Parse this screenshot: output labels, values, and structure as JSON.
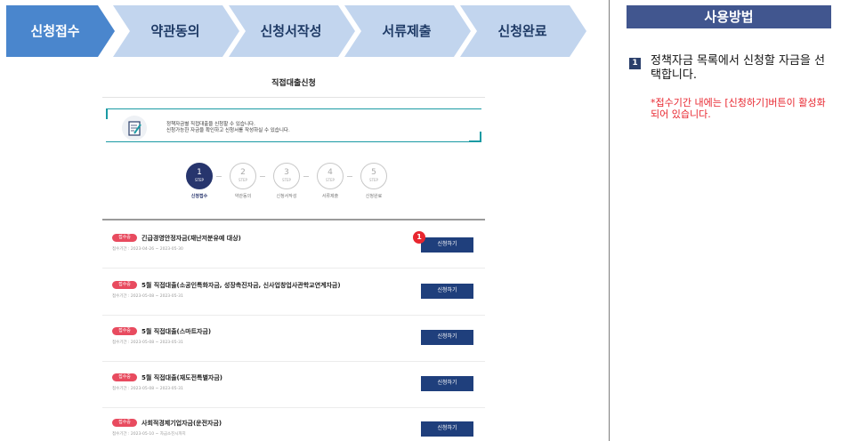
{
  "top_steps": [
    {
      "label": "신청접수",
      "active": true
    },
    {
      "label": "약관동의",
      "active": false
    },
    {
      "label": "신청서작성",
      "active": false
    },
    {
      "label": "서류제출",
      "active": false
    },
    {
      "label": "신청완료",
      "active": false
    }
  ],
  "colors": {
    "active_step": "#4a86cd",
    "inactive_step": "#c2d5ee",
    "guide_head": "#41568f",
    "apply_button": "#1f3f7c",
    "badge": "#e84b5f",
    "note": "#e8262f"
  },
  "guide": {
    "title": "사용방법",
    "step_number": "1",
    "instruction": "정책자금 목록에서 신청할 자금을 선택합니다.",
    "note": "*접수기간 내에는 [신청하기]버튼이 활성화 되어 있습니다."
  },
  "screen": {
    "page_title": "직접대출신청",
    "info_icon": "edit-document-icon",
    "info_lines": [
      "정책자금별 직접대출을 신청할 수 있습니다.",
      "신청가능한 자금을 확인하고 신청서를 작성하실 수 있습니다."
    ],
    "steps": [
      {
        "number": "1",
        "tag": "STEP",
        "label": "신청접수",
        "active": true
      },
      {
        "number": "2",
        "tag": "STEP",
        "label": "약관동의",
        "active": false
      },
      {
        "number": "3",
        "tag": "STEP",
        "label": "신청서작성",
        "active": false
      },
      {
        "number": "4",
        "tag": "STEP",
        "label": "서류제출",
        "active": false
      },
      {
        "number": "5",
        "tag": "STEP",
        "label": "신청완료",
        "active": false
      }
    ],
    "marker": "1",
    "items": [
      {
        "badge": "접수중",
        "title": "긴급경영안정자금(재난저분유예 대상)",
        "period": "접수기간 : 2023-04-26 ~ 2023-05-30",
        "button": "신청하기"
      },
      {
        "badge": "접수중",
        "title": "5월 직접대출(소공인특화자금, 성장촉진자금, 신사업창업사관학교연계자금)",
        "period": "접수기간 : 2023-05-08 ~ 2023-05-31",
        "button": "신청하기"
      },
      {
        "badge": "접수중",
        "title": "5월 직접대출(스마트자금)",
        "period": "접수기간 : 2023-05-08 ~ 2023-05-31",
        "button": "신청하기"
      },
      {
        "badge": "접수중",
        "title": "5월 직접대출(재도전특별자금)",
        "period": "접수기간 : 2023-05-08 ~ 2023-05-31",
        "button": "신청하기"
      },
      {
        "badge": "접수중",
        "title": "사회적경제기업자금(운전자금)",
        "period": "접수기간 : 2023-05-10 ~ 자금소진시까지",
        "button": "신청하기"
      }
    ]
  }
}
